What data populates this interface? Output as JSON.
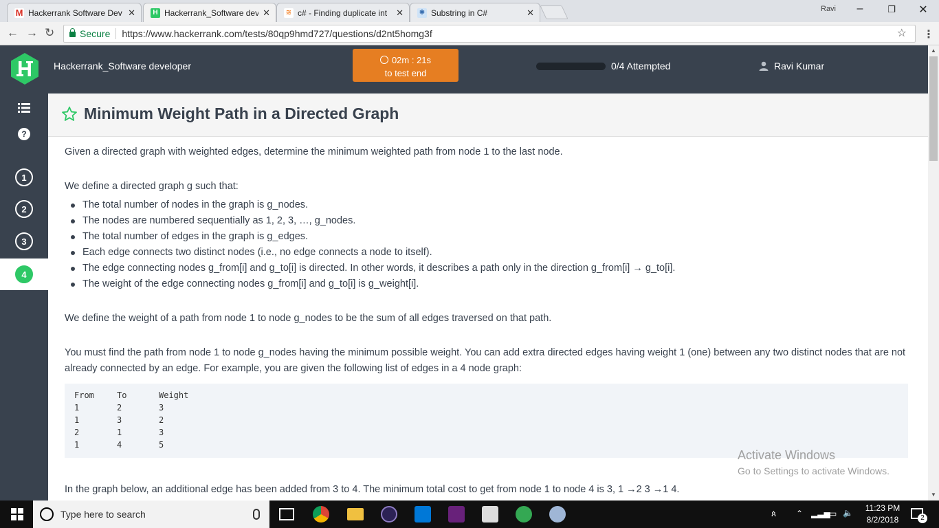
{
  "browser": {
    "tabs": [
      {
        "label": "Hackerrank Software Dev",
        "favicon": "M",
        "color": "#d93025"
      },
      {
        "label": "Hackerrank_Software dev",
        "favicon": "H",
        "color": "#2ec866"
      },
      {
        "label": "c# - Finding duplicate int",
        "favicon": "S",
        "color": "#f48024"
      },
      {
        "label": "Substring in C#",
        "favicon": "d",
        "color": "#8ab4f8"
      }
    ],
    "profile_name": "Ravi",
    "secure_label": "Secure",
    "url": "https://www.hackerrank.com/tests/80qp9hmd727/questions/d2nt5homg3f"
  },
  "header": {
    "test_title": "Hackerrank_Software developer",
    "timer_value": "02m : 21s",
    "timer_caption": "to test end",
    "progress_fraction": 0,
    "progress_label": "0/4 Attempted",
    "user_name": "Ravi Kumar"
  },
  "rail": {
    "questions": [
      "1",
      "2",
      "3",
      "4"
    ],
    "active_question": "4",
    "help_label": "?"
  },
  "question": {
    "title": "Minimum Weight Path in a Directed Graph",
    "intro": "Given a directed graph with weighted edges, determine the minimum weighted path from node 1 to the last node.",
    "define_intro": "We define a directed graph g such that:",
    "bullets": [
      "The total number of nodes in the graph is g_nodes.",
      "The nodes are numbered sequentially as 1, 2, 3, …, g_nodes.",
      "The total number of edges in the graph is g_edges.",
      "Each edge connects two distinct nodes (i.e., no edge connects a node to itself).",
      "The edge connecting nodes g_from[i] and g_to[i] is directed. In other words, it describes a path only in the direction g_from[i] → g_to[i].",
      "The weight of the edge connecting nodes g_from[i] and g_to[i] is g_weight[i]."
    ],
    "weight_def": "We define the weight of a path from node 1 to node g_nodes to be the sum of all edges traversed on that path.",
    "task": "You must find the path from node 1 to node g_nodes having the minimum possible weight. You can add extra directed edges having weight 1 (one) between any two distinct nodes that are not already connected by an edge. For example, you are given the following list of edges in a 4 node graph:",
    "edge_table": {
      "headers": [
        "From",
        "To",
        "Weight"
      ],
      "rows": [
        [
          "1",
          "2",
          "3"
        ],
        [
          "1",
          "3",
          "2"
        ],
        [
          "2",
          "1",
          "3"
        ],
        [
          "1",
          "4",
          "5"
        ]
      ]
    },
    "graph_note": "In the graph below, an additional edge has been added from 3 to 4. The minimum total cost to get from node 1 to node 4 is 3, 1 →2 3 →1 4."
  },
  "watermark": {
    "line1": "Activate Windows",
    "line2": "Go to Settings to activate Windows."
  },
  "taskbar": {
    "search_placeholder": "Type here to search",
    "time": "11:23 PM",
    "date": "8/2/2018",
    "notification_count": "2"
  }
}
